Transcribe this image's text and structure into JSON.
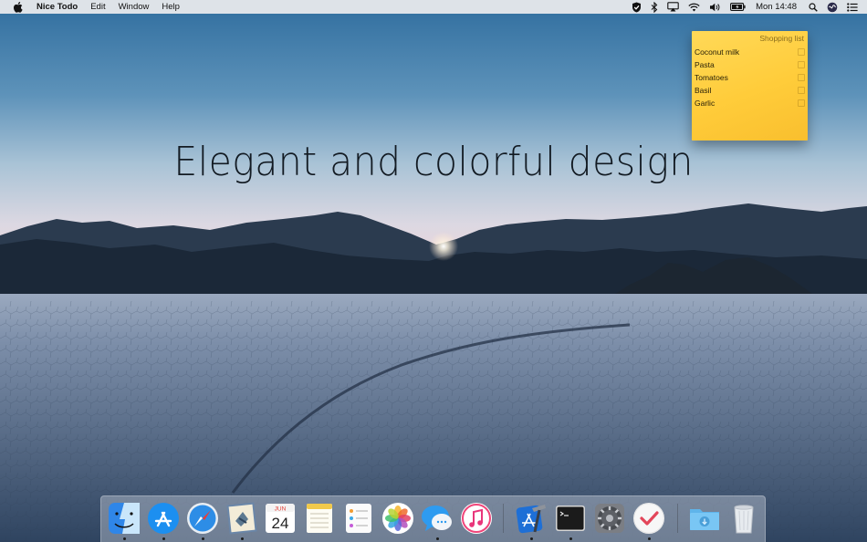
{
  "menubar": {
    "app_name": "Nice Todo",
    "menus": [
      "Edit",
      "Window",
      "Help"
    ],
    "clock": "Mon 14:48"
  },
  "headline": "Elegant and colorful design",
  "note": {
    "title": "Shopping list",
    "items": [
      "Coconut milk",
      "Pasta",
      "Tomatoes",
      "Basil",
      "Garlic"
    ],
    "color": "#ffd24a"
  },
  "dock": {
    "apps": [
      {
        "name": "finder-icon",
        "running": true
      },
      {
        "name": "app-store-icon",
        "running": true
      },
      {
        "name": "safari-icon",
        "running": true
      },
      {
        "name": "mail-icon",
        "running": true
      },
      {
        "name": "calendar-icon",
        "running": false,
        "calendar_month": "JUN",
        "calendar_day": "24"
      },
      {
        "name": "notes-icon",
        "running": false
      },
      {
        "name": "reminders-icon",
        "running": false
      },
      {
        "name": "photos-icon",
        "running": false
      },
      {
        "name": "messages-icon",
        "running": true
      },
      {
        "name": "itunes-icon",
        "running": false
      },
      {
        "name": "xcode-icon",
        "running": true
      },
      {
        "name": "terminal-icon",
        "running": true
      },
      {
        "name": "system-preferences-icon",
        "running": false
      },
      {
        "name": "nice-todo-icon",
        "running": true
      },
      {
        "name": "downloads-folder-icon",
        "running": false
      },
      {
        "name": "trash-icon",
        "running": false
      }
    ]
  },
  "colors": {
    "sky_top": "#3f7aa8",
    "sky_horizon": "#ecd6dc",
    "mountains": "#1a2633",
    "playa": "#4f6a8a"
  }
}
